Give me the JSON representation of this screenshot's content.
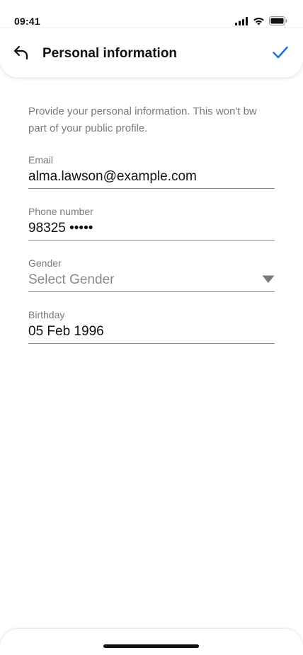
{
  "status_bar": {
    "time": "09:41"
  },
  "header": {
    "title": "Personal information",
    "back_icon": "undo-back-arrow-icon",
    "confirm_icon": "checkmark-icon"
  },
  "intro_text": "Provide your personal information. This won't bw part of your public profile.",
  "fields": {
    "email": {
      "label": "Email",
      "value": "alma.lawson@example.com"
    },
    "phone": {
      "label": "Phone number",
      "value": "98325 •••••"
    },
    "gender": {
      "label": "Gender",
      "placeholder": "Select Gender"
    },
    "birthday": {
      "label": "Birthday",
      "value": "05 Feb 1996"
    }
  },
  "colors": {
    "accent": "#1a73e8",
    "label_gray": "#7a7a7a",
    "text": "#111111"
  }
}
